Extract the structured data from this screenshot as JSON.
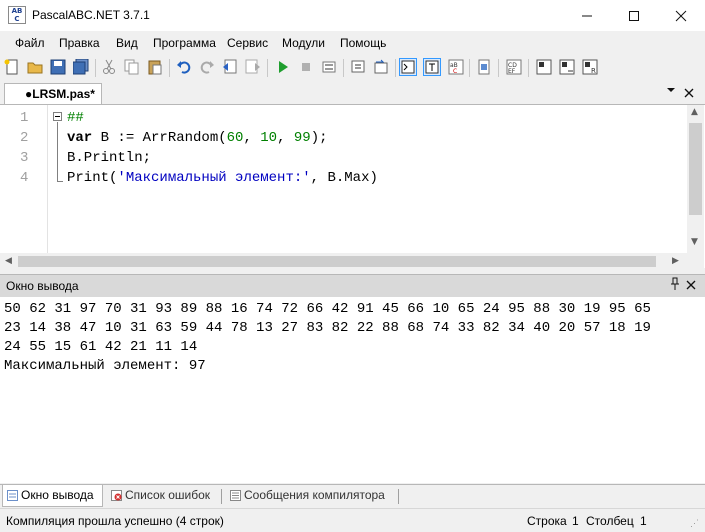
{
  "window": {
    "title": "PascalABC.NET 3.7.1",
    "app_icon_text": "AB C"
  },
  "menu": [
    "Файл",
    "Правка",
    "Вид",
    "Программа",
    "Сервис",
    "Модули",
    "Помощь"
  ],
  "editor_tab": {
    "label": "●LRSM.pas*"
  },
  "editor": {
    "line_numbers": [
      "1",
      "2",
      "3",
      "4"
    ],
    "lines": {
      "l1": "##",
      "l2_kw": "var",
      "l2_a": " B := ArrRandom(",
      "l2_n1": "60",
      "l2_b": ", ",
      "l2_n2": "10",
      "l2_c": ", ",
      "l2_n3": "99",
      "l2_d": ");",
      "l3": "B.Println;",
      "l4_a": "Print(",
      "l4_str": "'Максимальный элемент:'",
      "l4_b": ", B.Max)"
    }
  },
  "output_panel": {
    "title": "Окно вывода",
    "lines": [
      "50 62 31 97 70 31 93 89 88 16 74 72 66 42 91 45 66 10 65 24 95 88 30 19 95 65",
      "23 14 38 47 10 31 63 59 44 78 13 27 83 82 22 88 68 74 33 82 34 40 20 57 18 19",
      "24 55 15 61 42 21 11 14",
      "Максимальный элемент: 97"
    ]
  },
  "bottom_tabs": [
    "Окно вывода",
    "Список ошибок",
    "Сообщения компилятора"
  ],
  "status": {
    "message": "Компиляция прошла успешно (4 строк)",
    "row_label": "Строка",
    "row_value": "1",
    "col_label": "Столбец",
    "col_value": "1"
  },
  "colors": {
    "keyword": "#000000",
    "number": "#008000",
    "string": "#0000c0",
    "selection": "#3399ff"
  }
}
